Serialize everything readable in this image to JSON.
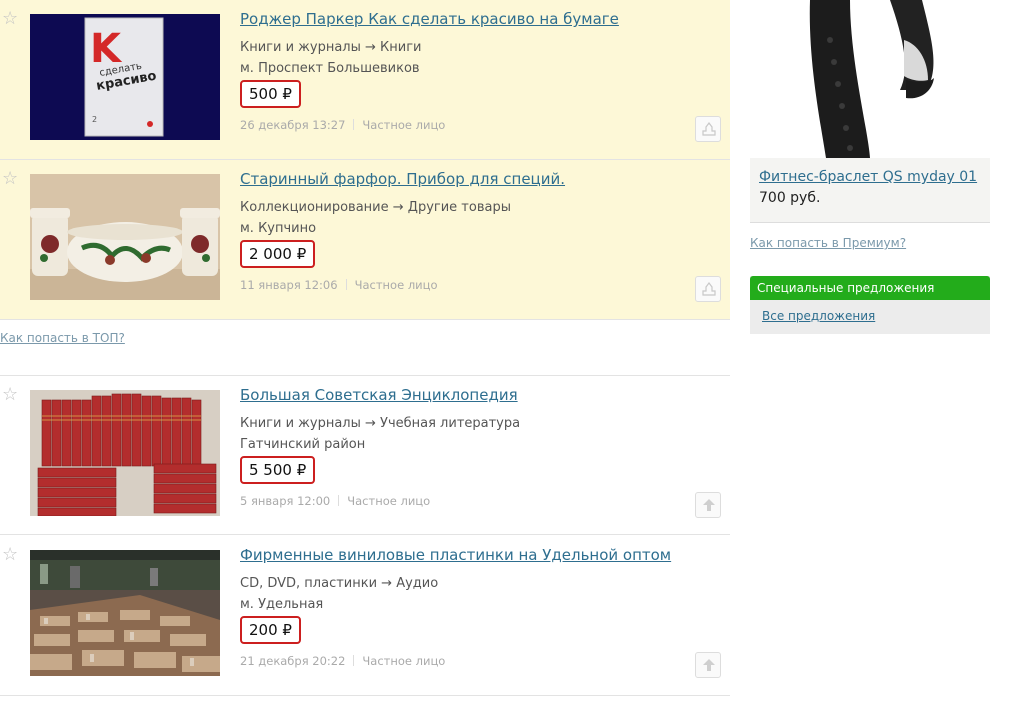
{
  "listings": [
    {
      "title": "Роджер Паркер Как сделать красиво на бумаге",
      "category": "Книги и журналы → Книги",
      "location": "м. Проспект Большевиков",
      "price": "500 ₽",
      "date": "26 декабря 13:27",
      "seller": "Частное лицо",
      "premium": true,
      "action": "premium-icon",
      "image": "book-cover"
    },
    {
      "title": "Старинный фарфор. Прибор для специй.",
      "category": "Коллекционирование → Другие товары",
      "location": "м. Купчино",
      "price": "2 000 ₽",
      "date": "11 января 12:06",
      "seller": "Частное лицо",
      "premium": true,
      "action": "premium-icon",
      "image": "porcelain"
    },
    {
      "title": "Большая Советская Энциклопедия",
      "category": "Книги и журналы → Учебная литература",
      "location": "Гатчинский район",
      "price": "5 500 ₽",
      "date": "5 января 12:00",
      "seller": "Частное лицо",
      "premium": false,
      "action": "arrow-up-icon",
      "image": "red-books"
    },
    {
      "title": "Фирменные виниловые пластинки на Удельной оптом",
      "category": "CD, DVD, пластинки → Аудио",
      "location": "м. Удельная",
      "price": "200 ₽",
      "date": "21 декабря 20:22",
      "seller": "Частное лицо",
      "premium": false,
      "action": "arrow-up-icon",
      "image": "vinyl-market"
    }
  ],
  "top_link": "Как попасть в ТОП?",
  "sidebar": {
    "ad": {
      "title": "Фитнес-браслет QS myday 01",
      "price": "700 руб."
    },
    "premium_link": "Как попасть в Премиум?",
    "offers": {
      "header": "Специальные предложения",
      "link": "Все предложения"
    }
  },
  "colors": {
    "premium_bg": "#fdf8d7",
    "link": "#2e6e8f",
    "price_border": "#cc1f1f",
    "offers_header": "#23ac1b"
  }
}
